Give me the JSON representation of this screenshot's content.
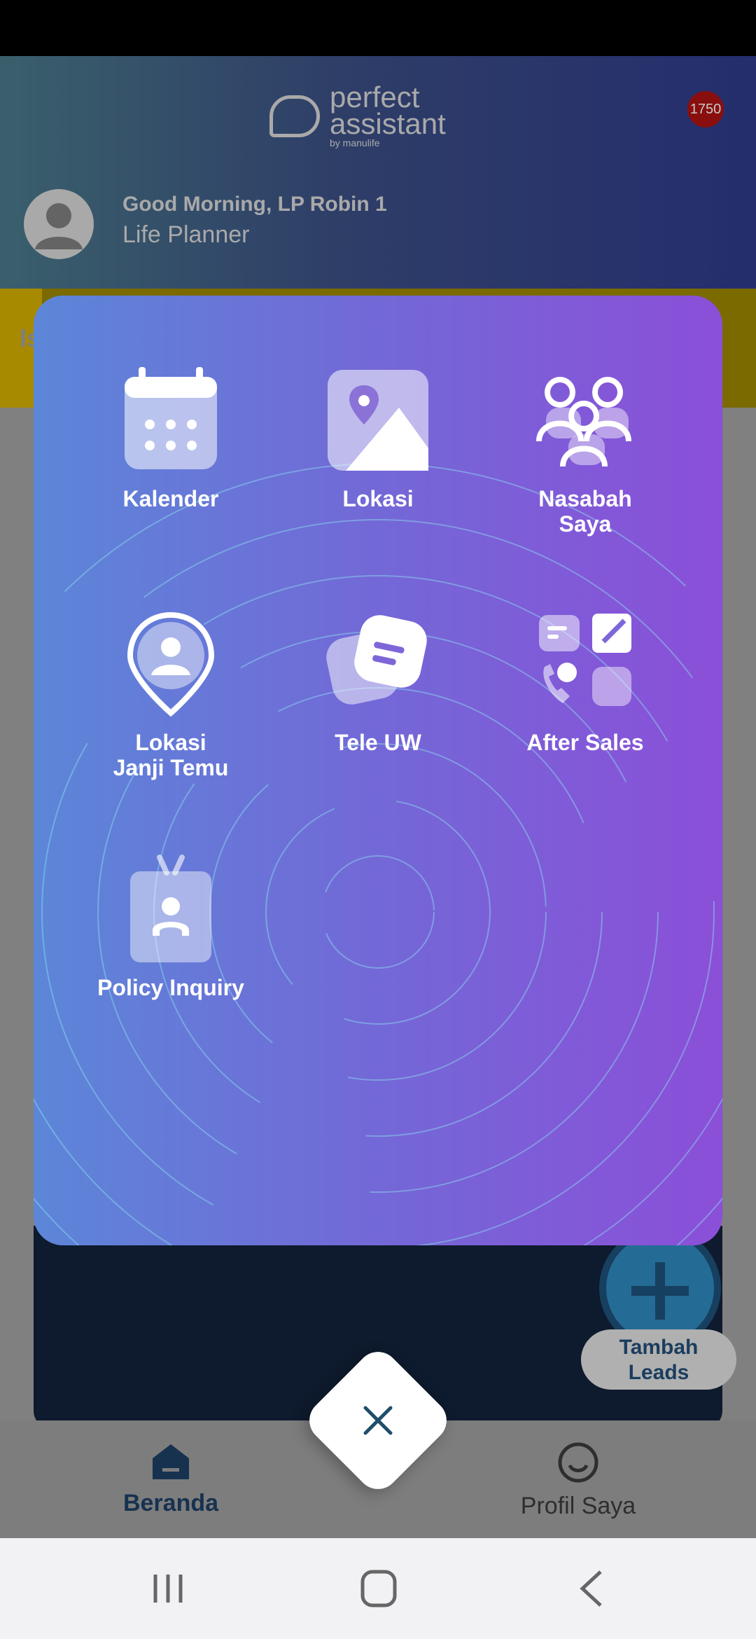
{
  "header": {
    "logo": {
      "line1": "perfect",
      "line2": "assistant",
      "by": "by manulife"
    },
    "notification_count": "1750",
    "greeting": "Good Morning, LP Robin 1",
    "role": "Life Planner"
  },
  "behind": {
    "strip_initial": "Is"
  },
  "menu": {
    "items": [
      {
        "label": "Kalender",
        "icon": "calendar-icon"
      },
      {
        "label": "Lokasi",
        "icon": "map-icon"
      },
      {
        "label_line1": "Nasabah",
        "label_line2": "Saya",
        "icon": "people-icon"
      },
      {
        "label_line1": "Lokasi",
        "label_line2": "Janji Temu",
        "icon": "location-pin-person-icon"
      },
      {
        "label": "Tele UW",
        "icon": "chat-bubbles-icon"
      },
      {
        "label": "After Sales",
        "icon": "after-sales-icon"
      },
      {
        "label": "Policy Inquiry",
        "icon": "id-badge-icon"
      }
    ]
  },
  "fab": {
    "label_line1": "Tambah",
    "label_line2": "Leads"
  },
  "bottom_nav": {
    "home": "Beranda",
    "profile": "Profil Saya"
  },
  "colors": {
    "card_start": "#5c86d8",
    "card_end": "#8b4fd8",
    "accent_dark": "#17324f"
  }
}
